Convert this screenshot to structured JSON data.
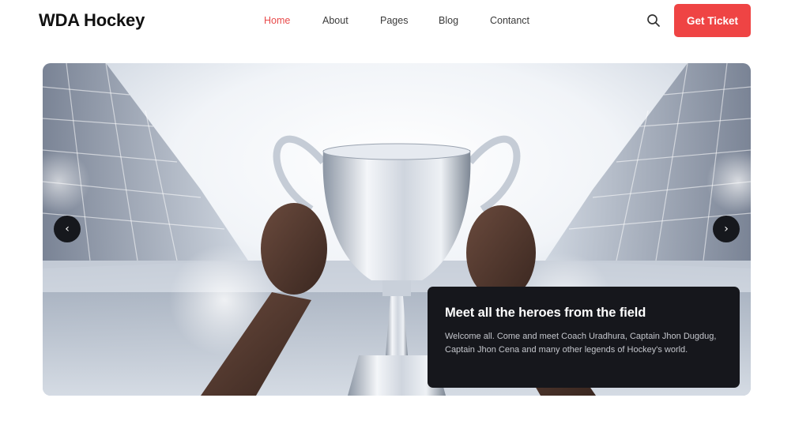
{
  "brand": {
    "name": "WDA Hockey"
  },
  "nav": {
    "items": [
      {
        "label": "Home",
        "active": true
      },
      {
        "label": "About",
        "active": false
      },
      {
        "label": "Pages",
        "active": false
      },
      {
        "label": "Blog",
        "active": false
      },
      {
        "label": "Contanct",
        "active": false
      }
    ]
  },
  "header": {
    "search_icon": "search-icon",
    "cta_label": "Get Ticket"
  },
  "hero": {
    "prev_glyph": "‹",
    "next_glyph": "›",
    "caption": {
      "title": "Meet all the heroes from the field",
      "text": "Welcome all. Come and meet Coach Uradhura, Captain Jhon Dugdug, Captain Jhon Cena and many other legends of Hockey's world."
    }
  },
  "colors": {
    "accent": "#ef4444",
    "active_nav": "#e84a4a",
    "caption_bg": "#16171c",
    "arrow_bg": "#16181d"
  }
}
